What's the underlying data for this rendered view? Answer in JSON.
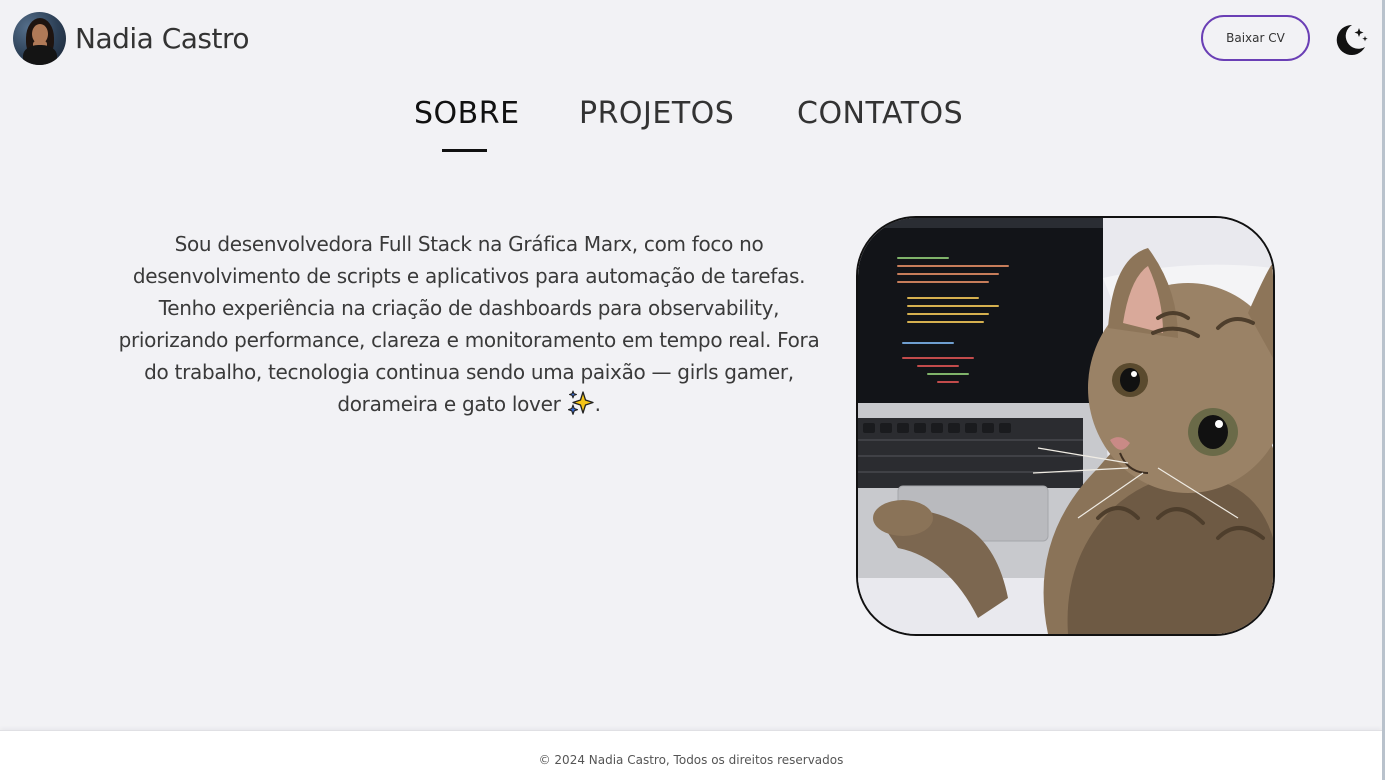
{
  "header": {
    "name": "Nadia Castro",
    "cv_button_label": "Baixar CV",
    "theme_icon": "moon-stars-icon",
    "avatar_icon": "avatar-photo"
  },
  "nav": {
    "tabs": [
      {
        "label": "SOBRE",
        "active": true
      },
      {
        "label": "PROJETOS",
        "active": false
      },
      {
        "label": "CONTATOS",
        "active": false
      }
    ]
  },
  "about": {
    "text": "Sou desenvolvedora Full Stack na Gráfica Marx, com foco no desenvolvimento de scripts e aplicativos para automação de tarefas. Tenho experiência na criação de dashboards para observability, priorizando performance, clareza e monitoramento em tempo real. Fora do trabalho, tecnologia continua sendo uma paixão — girls gamer, dorameira e gato lover",
    "trailing": ".",
    "emoji_icon": "sparkles-icon",
    "photo": "cat-with-laptop-photo"
  },
  "footer": {
    "text": "© 2024 Nadia Castro, Todos os direitos reservados"
  },
  "colors": {
    "background": "#f2f2f5",
    "accent": "#6a3fb5",
    "text": "#333333",
    "footer_bg": "#ffffff"
  }
}
